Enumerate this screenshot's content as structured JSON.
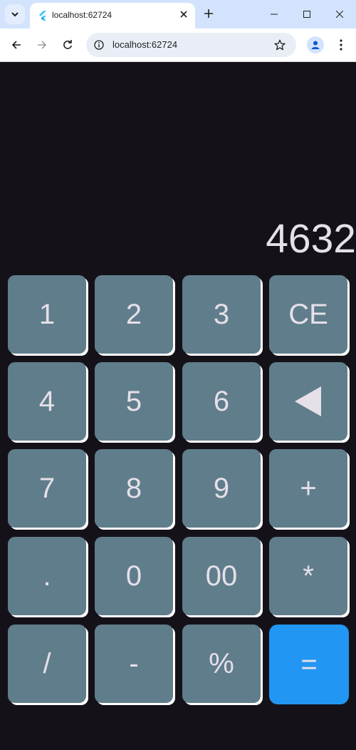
{
  "browser": {
    "tab_title": "localhost:62724",
    "url": "localhost:62724"
  },
  "calculator": {
    "display": "4632",
    "keys": [
      {
        "label": "1",
        "name": "key-1"
      },
      {
        "label": "2",
        "name": "key-2"
      },
      {
        "label": "3",
        "name": "key-3"
      },
      {
        "label": "CE",
        "name": "key-clear-entry"
      },
      {
        "label": "4",
        "name": "key-4"
      },
      {
        "label": "5",
        "name": "key-5"
      },
      {
        "label": "6",
        "name": "key-6"
      },
      {
        "label": "",
        "name": "key-backspace",
        "icon": "backspace-triangle-icon"
      },
      {
        "label": "7",
        "name": "key-7"
      },
      {
        "label": "8",
        "name": "key-8"
      },
      {
        "label": "9",
        "name": "key-9"
      },
      {
        "label": "+",
        "name": "key-plus"
      },
      {
        "label": ".",
        "name": "key-decimal"
      },
      {
        "label": "0",
        "name": "key-0"
      },
      {
        "label": "00",
        "name": "key-double-zero"
      },
      {
        "label": "*",
        "name": "key-multiply"
      },
      {
        "label": "/",
        "name": "key-divide"
      },
      {
        "label": "-",
        "name": "key-minus"
      },
      {
        "label": "%",
        "name": "key-percent"
      },
      {
        "label": "=",
        "name": "key-equals"
      }
    ],
    "colors": {
      "background": "#141218",
      "key": "#607d8b",
      "equals_key": "#2196f3",
      "text": "#e6e0e9"
    }
  }
}
